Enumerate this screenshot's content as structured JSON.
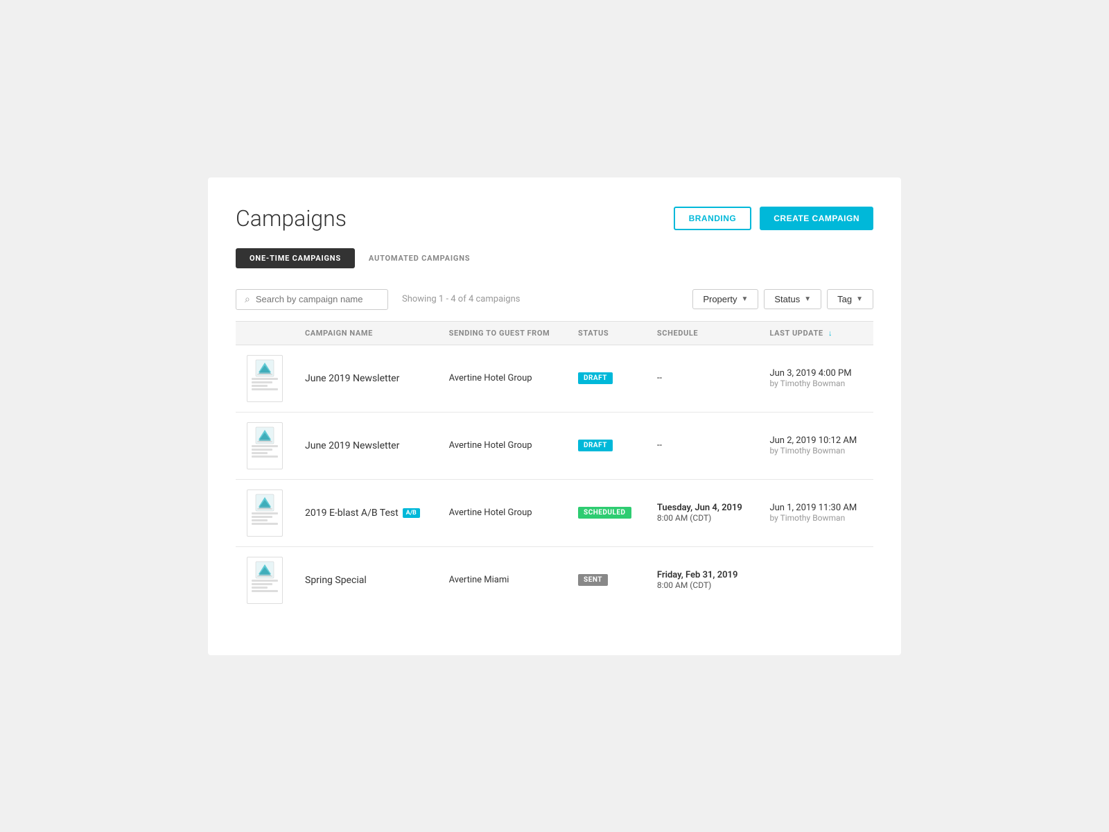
{
  "page": {
    "title": "Campaigns",
    "buttons": {
      "branding": "BRANDING",
      "create": "CREATE CAMPAIGN"
    },
    "tabs": [
      {
        "id": "one-time",
        "label": "ONE-TIME CAMPAIGNS",
        "active": true
      },
      {
        "id": "automated",
        "label": "AUTOMATED CAMPAIGNS",
        "active": false
      }
    ],
    "search": {
      "placeholder": "Search by campaign name"
    },
    "showing_text": "Showing 1 - 4 of 4 campaigns",
    "filters": [
      {
        "id": "property",
        "label": "Property"
      },
      {
        "id": "status",
        "label": "Status"
      },
      {
        "id": "tag",
        "label": "Tag"
      }
    ],
    "table": {
      "headers": [
        {
          "id": "campaign-name",
          "label": "CAMPAIGN NAME",
          "sortable": false
        },
        {
          "id": "sending-to",
          "label": "SENDING TO GUEST FROM",
          "sortable": false
        },
        {
          "id": "status",
          "label": "STATUS",
          "sortable": false
        },
        {
          "id": "schedule",
          "label": "SCHEDULE",
          "sortable": false
        },
        {
          "id": "last-update",
          "label": "LAST UPDATE",
          "sortable": true,
          "sort_icon": "↓"
        }
      ],
      "rows": [
        {
          "id": 1,
          "name": "June 2019 Newsletter",
          "ab_test": false,
          "sending_from": "Avertine Hotel Group",
          "status": "DRAFT",
          "status_type": "draft",
          "schedule": "--",
          "schedule_time": "",
          "last_update": "Jun 3, 2019 4:00 PM",
          "last_update_by": "by Timothy Bowman"
        },
        {
          "id": 2,
          "name": "June 2019 Newsletter",
          "ab_test": false,
          "sending_from": "Avertine Hotel Group",
          "status": "DRAFT",
          "status_type": "draft",
          "schedule": "--",
          "schedule_time": "",
          "last_update": "Jun 2, 2019 10:12 AM",
          "last_update_by": "by Timothy Bowman"
        },
        {
          "id": 3,
          "name": "2019 E-blast A/B Test",
          "ab_test": true,
          "ab_label": "A/B",
          "sending_from": "Avertine Hotel Group",
          "status": "SCHEDULED",
          "status_type": "scheduled",
          "schedule": "Tuesday, Jun 4, 2019",
          "schedule_time": "8:00 AM (CDT)",
          "last_update": "Jun 1, 2019 11:30 AM",
          "last_update_by": "by Timothy Bowman"
        },
        {
          "id": 4,
          "name": "Spring Special",
          "ab_test": false,
          "sending_from": "Avertine Miami",
          "status": "SENT",
          "status_type": "sent",
          "schedule": "Friday, Feb 31, 2019",
          "schedule_time": "8:00 AM (CDT)",
          "last_update": "",
          "last_update_by": ""
        }
      ]
    }
  }
}
